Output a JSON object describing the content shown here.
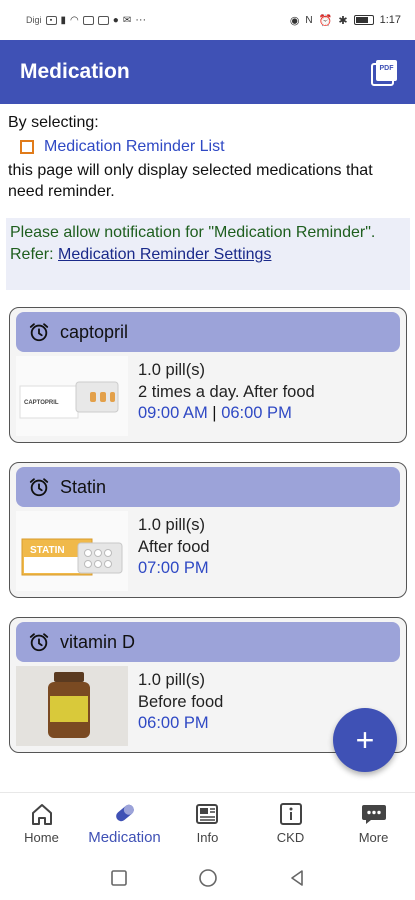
{
  "status_bar": {
    "carrier": "Digi",
    "time": "1:17"
  },
  "app_bar": {
    "title": "Medication",
    "pdf_icon": "pdf-icon",
    "pdf_label": "PDF"
  },
  "intro": {
    "line1": "By selecting:",
    "link": "Medication Reminder List",
    "line2": "this page will only display selected medications that need reminder."
  },
  "notice": {
    "text": "Please allow notification for \"Medication Reminder\".",
    "refer_label": "Refer: ",
    "refer_link": "Medication Reminder Settings"
  },
  "medications": [
    {
      "name": "captopril",
      "dose": "1.0 pill(s)",
      "instruction": "2 times a day. After food",
      "time1": "09:00 AM",
      "separator": " | ",
      "time2": "06:00 PM",
      "image_icon": "captopril-pack-image"
    },
    {
      "name": "Statin",
      "dose": "1.0 pill(s)",
      "instruction": "After food",
      "time1": "07:00 PM",
      "image_icon": "statin-pack-image"
    },
    {
      "name": "vitamin D",
      "dose": "1.0 pill(s)",
      "instruction": "Before food",
      "time1": "06:00 PM",
      "image_icon": "vitamin-bottle-image"
    }
  ],
  "fab": {
    "label": "+",
    "icon": "plus-icon"
  },
  "bottom_nav": [
    {
      "label": "Home",
      "icon": "home-icon"
    },
    {
      "label": "Medication",
      "icon": "pill-icon",
      "active": true
    },
    {
      "label": "Info",
      "icon": "news-icon"
    },
    {
      "label": "CKD",
      "icon": "info-icon"
    },
    {
      "label": "More",
      "icon": "more-icon"
    }
  ],
  "colors": {
    "primary": "#3f51b5",
    "card_header": "#9ca3d9",
    "link": "#2f49c4",
    "notice_text": "#1e5e1e",
    "notice_bg": "#eceef8",
    "checkbox": "#e07b1a"
  }
}
